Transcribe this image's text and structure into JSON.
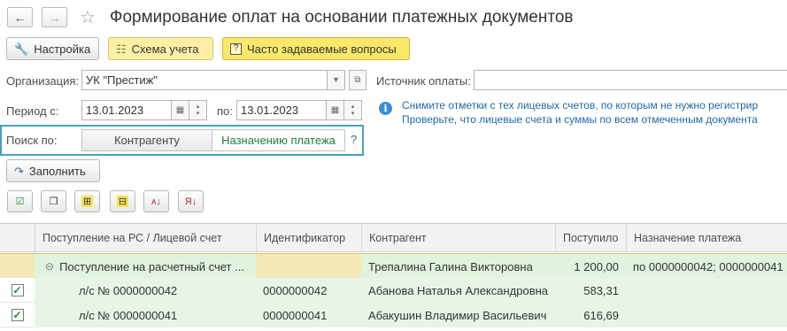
{
  "window": {
    "title": "Формирование оплат на основании платежных документов",
    "back_glyph": "←",
    "forward_glyph": "→",
    "favorite_glyph": "☆"
  },
  "toolbar": {
    "settings_label": "Настройка",
    "scheme_label": "Схема учета",
    "faq_label": "Часто задаваемые вопросы",
    "fill_label": "Заполнить"
  },
  "form": {
    "organization_label": "Организация:",
    "organization_value": "УК \"Престиж\"",
    "source_label": "Источник оплаты:",
    "source_value": "",
    "period_label": "Период с:",
    "period_from": "13.01.2023",
    "period_to_label": "по:",
    "period_to": "13.01.2023",
    "search_label": "Поиск по:",
    "search_options": [
      "Контрагенту",
      "Назначению платежа"
    ],
    "search_selected": "Назначению платежа",
    "help_glyph": "?"
  },
  "info": {
    "line1": "Снимите отметки с тех лицевых счетов, по которым не нужно регистрир",
    "line2": "Проверьте, что лицевые счета и суммы по всем отмеченным документа"
  },
  "table": {
    "columns": [
      "Поступление на РС / Лицевой счет",
      "Идентификатор",
      "Контрагент",
      "Поступило",
      "Назначение платежа"
    ],
    "group_row": {
      "expander": "⊝",
      "account": "Поступление на расчетный счет ...",
      "identifier": "",
      "counterparty": "Трепалина Галина Викторовна",
      "received": "1 200,00",
      "purpose": "по 0000000042; 0000000041"
    },
    "rows": [
      {
        "checked": true,
        "account": "л/с № 0000000042",
        "identifier": "0000000042",
        "counterparty": "Абанова Наталья Александровна",
        "received": "583,31",
        "purpose": ""
      },
      {
        "checked": true,
        "account": "л/с № 0000000041",
        "identifier": "0000000041",
        "counterparty": "Абакушин Владимир Васильевич",
        "received": "616,69",
        "purpose": ""
      }
    ]
  },
  "colors": {
    "group_row_bg": "#f5e8b4",
    "data_row_bg": "#e6f5e6",
    "radio_frame": "#46a3b8",
    "accent_yellow": "#fbe86a"
  }
}
